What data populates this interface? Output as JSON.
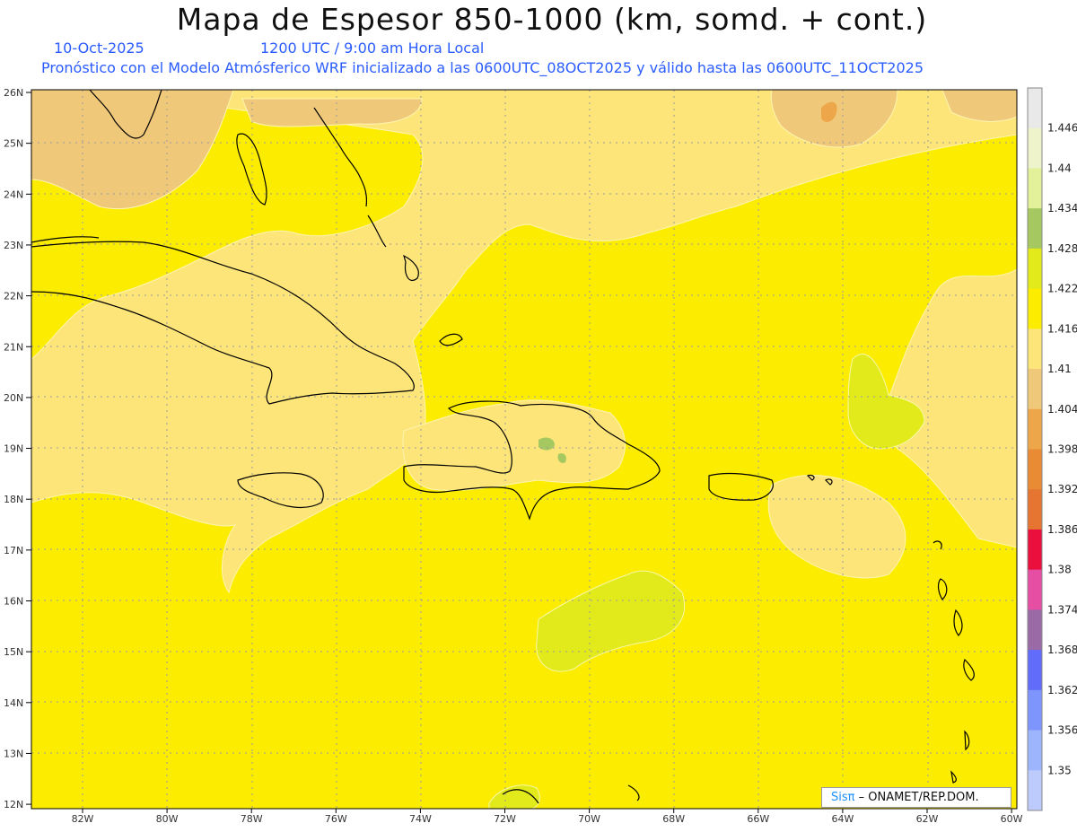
{
  "header": {
    "title": "Mapa de Espesor 850-1000 (km, somd. + cont.)",
    "date": "10-Oct-2025",
    "time": "1200 UTC / 9:00 am Hora Local",
    "info": "Pronóstico con el Modelo Atmósferico WRF inicializado a las 0600UTC_08OCT2025 y válido hasta las  0600UTC_11OCT2025"
  },
  "map": {
    "lat_labels": [
      "26N",
      "25N",
      "24N",
      "23N",
      "22N",
      "21N",
      "20N",
      "19N",
      "18N",
      "17N",
      "16N",
      "15N",
      "14N",
      "13N",
      "12N"
    ],
    "lon_labels": [
      "82W",
      "80W",
      "78W",
      "76W",
      "74W",
      "72W",
      "70W",
      "68W",
      "66W",
      "64W",
      "62W",
      "60W"
    ],
    "grid": true
  },
  "colorbar": {
    "labels": [
      "1.446",
      "1.44",
      "1.434",
      "1.428",
      "1.422",
      "1.416",
      "1.41",
      "1.404",
      "1.398",
      "1.392",
      "1.386",
      "1.38",
      "1.374",
      "1.368",
      "1.362",
      "1.356",
      "1.35"
    ],
    "colors": [
      "#e9e9e9",
      "#eef3cc",
      "#e3f19a",
      "#a5c860",
      "#e3ea1c",
      "#fcec00",
      "#fde57a",
      "#f0c87a",
      "#eda74a",
      "#e98b34",
      "#e57530",
      "#ea0f3d",
      "#e64ea4",
      "#9a6aa7",
      "#626cfb",
      "#7e95fd",
      "#9cb5fd",
      "#bccbfc"
    ]
  },
  "credit": {
    "brand": "Sisπ",
    "org": " – ONAMET/REP.DOM."
  }
}
